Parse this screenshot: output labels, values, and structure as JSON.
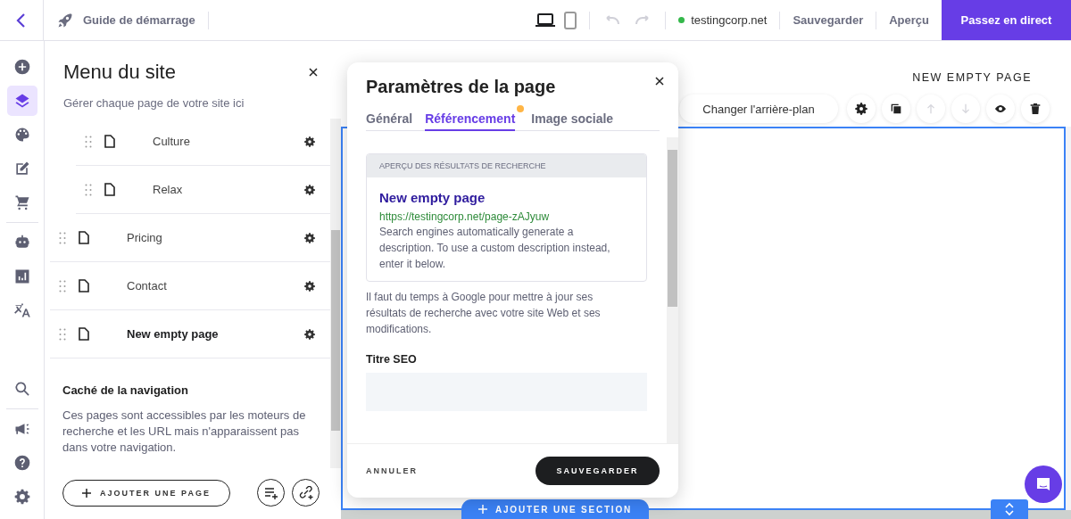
{
  "topbar": {
    "guide": "Guide de démarrage",
    "devices": [
      {
        "selected": true
      },
      {
        "selected": false
      }
    ],
    "history": [
      {
        "disabled": true
      },
      {
        "disabled": true
      }
    ],
    "domain": "testingcorp.net",
    "save": "Sauvegarder",
    "preview": "Aperçu",
    "publish": "Passez en direct"
  },
  "rail": [
    {
      "selected": false
    },
    {
      "selected": true
    },
    {
      "selected": false
    },
    {
      "selected": false
    },
    {
      "selected": false
    },
    {
      "selected": false
    },
    {
      "selected": false
    },
    {
      "selected": false
    },
    {
      "selected": false
    },
    {
      "selected": false
    },
    {
      "selected": false
    },
    {
      "selected": false
    }
  ],
  "site_menu": {
    "title": "Menu du site",
    "subtitle": "Gérer chaque page de votre site ici",
    "pages": [
      {
        "children": [
          {
            "label": "Culture",
            "selected": false
          },
          {
            "label": "Relax",
            "selected": false
          }
        ]
      },
      {
        "label": "Pricing",
        "selected": false
      },
      {
        "label": "Contact",
        "selected": false
      },
      {
        "label": "New empty page",
        "selected": true
      }
    ],
    "hidden_title": "Caché de la navigation",
    "hidden_text": "Ces pages sont accessibles par les moteurs de recherche et les URL mais n'apparaissent pas dans votre navigation.",
    "add_page": "AJOUTER UNE PAGE"
  },
  "canvas": {
    "page_title": "NEW EMPTY PAGE",
    "change_background": "Changer l'arrière-plan",
    "tools": [
      {
        "disabled": false
      },
      {
        "disabled": false
      },
      {
        "disabled": true
      },
      {
        "disabled": true
      },
      {
        "disabled": false
      },
      {
        "disabled": false
      }
    ],
    "add_section": "AJOUTER UNE SECTION"
  },
  "modal": {
    "title": "Paramètres de la page",
    "tabs": [
      {
        "label": "Général",
        "selected": false,
        "badge": false
      },
      {
        "label": "Référencement",
        "selected": true,
        "badge": true
      },
      {
        "label": "Image sociale",
        "selected": false,
        "badge": false
      }
    ],
    "preview_heading": "APERÇU DES RÉSULTATS DE RECHERCHE",
    "preview_title": "New empty page",
    "preview_url": "https://testingcorp.net/page-zAJyuw",
    "preview_description": "Search engines automatically generate a description. To use a custom description instead, enter it below.",
    "note": "Il faut du temps à Google pour mettre à jour ses résultats de recherche avec votre site Web et ses modifications.",
    "seo_title_label": "Titre SEO",
    "cancel": "ANNULER",
    "save": "SAUVEGARDER"
  }
}
